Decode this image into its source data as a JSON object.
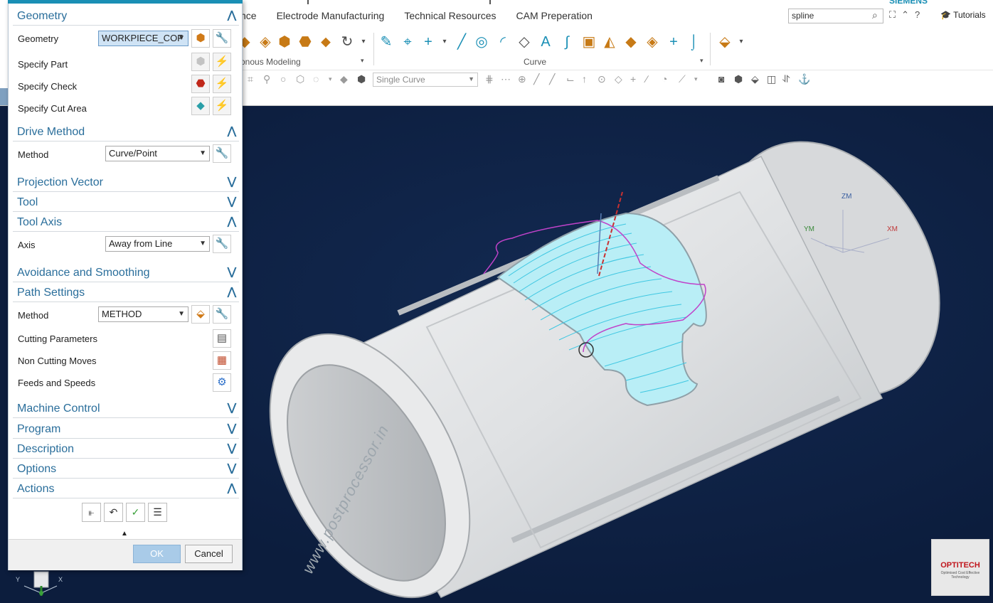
{
  "menu": {
    "fragment": "nce",
    "items": [
      "Electrode Manufacturing",
      "Technical Resources",
      "CAM Preperation"
    ]
  },
  "search": {
    "value": "spline"
  },
  "window_icons": [
    "fullscreen-icon",
    "collapse-ribbon-icon",
    "help-icon"
  ],
  "tutorials_label": "Tutorials",
  "brand_fragment": "SIEMENS",
  "ribbon": {
    "group_modeling": "onous Modeling",
    "group_curve": "Curve",
    "curve_filter": "Single Curve"
  },
  "dialog": {
    "geometry": {
      "title": "Geometry",
      "geometry_label": "Geometry",
      "geometry_value": "WORKPIECE_COF",
      "specify_part": "Specify Part",
      "specify_check": "Specify Check",
      "specify_cut_area": "Specify Cut Area"
    },
    "drive_method": {
      "title": "Drive Method",
      "method_label": "Method",
      "method_value": "Curve/Point"
    },
    "projection_vector": {
      "title": "Projection Vector"
    },
    "tool": {
      "title": "Tool"
    },
    "tool_axis": {
      "title": "Tool Axis",
      "axis_label": "Axis",
      "axis_value": "Away from Line"
    },
    "avoidance": {
      "title": "Avoidance and Smoothing"
    },
    "path_settings": {
      "title": "Path Settings",
      "method_label": "Method",
      "method_value": "METHOD",
      "cutting_parameters": "Cutting Parameters",
      "non_cutting_moves": "Non Cutting Moves",
      "feeds_and_speeds": "Feeds and Speeds"
    },
    "machine_control": {
      "title": "Machine Control"
    },
    "program": {
      "title": "Program"
    },
    "description": {
      "title": "Description"
    },
    "options": {
      "title": "Options"
    },
    "actions": {
      "title": "Actions"
    },
    "ok_label": "OK",
    "cancel_label": "Cancel"
  },
  "viewport": {
    "axis_zm": "ZM",
    "axis_ym": "YM",
    "axis_xm": "XM",
    "triad_x": "X",
    "triad_y": "Y",
    "watermark": "www.postprocessor.in",
    "logo_text": "OPTITECH",
    "logo_tagline": "Optimised Cost Effective Technology",
    "colors": {
      "background": "#0c1d3d",
      "toolpath": "#4fd0e8",
      "part": "#e6e8ea",
      "accent": "#1a8fb5"
    }
  }
}
